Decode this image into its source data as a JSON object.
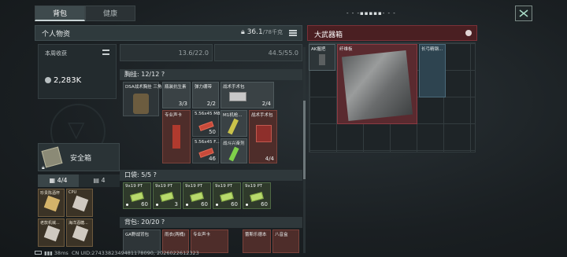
{
  "tabs": [
    {
      "label": "背包",
      "active": true
    },
    {
      "label": "健康",
      "active": false
    }
  ],
  "top_signal": "- - -▪▪▪▪▪- - -",
  "personal": {
    "title": "个人物资",
    "weight_current": "36.1",
    "weight_max": "/78千克",
    "capacity_left": "13.6/22.0",
    "capacity_right": "44.5/55.0"
  },
  "income": {
    "label": "本周收获",
    "value": "2,283K"
  },
  "safebox": {
    "label": "安全箱"
  },
  "subtabs": [
    {
      "label": "4/4",
      "active": true
    },
    {
      "label": "4",
      "active": false
    }
  ],
  "pocket_items": [
    {
      "name": "珍贵陈酒杯"
    },
    {
      "name": "CPU"
    },
    {
      "name": "老款机械..."
    },
    {
      "name": "海洋酒糖..."
    }
  ],
  "chest": {
    "header": "胸挂: 12/12 ?",
    "items": [
      {
        "name": "DSA战术胸挂 三角",
        "qty": ""
      },
      {
        "name": "瓶装抗生素",
        "qty": "3/3"
      },
      {
        "name": "弹力绷带",
        "qty": "2/2"
      },
      {
        "name": "战术手术包",
        "qty": "2/4"
      },
      {
        "name": "专业声卡",
        "qty": ""
      },
      {
        "name": "5.56x45 M855A1",
        "qty": "50"
      },
      {
        "name": "M1机枪...",
        "qty": ""
      },
      {
        "name": "5.56x45 F...",
        "qty": "46"
      },
      {
        "name": "战斗兴奋剂",
        "qty": ""
      },
      {
        "name": "战术手术包",
        "qty": "4/4"
      }
    ]
  },
  "pockets": {
    "header": "口袋: 5/5 ?",
    "items": [
      {
        "name": "9x19 PT",
        "qty": "60"
      },
      {
        "name": "9x19 PT",
        "qty": "3"
      },
      {
        "name": "9x19 PT",
        "qty": "60"
      },
      {
        "name": "9x19 PT",
        "qty": "60"
      },
      {
        "name": "9x19 PT",
        "qty": "60"
      }
    ]
  },
  "backpack": {
    "header": "背包: 20/20 ?",
    "items": [
      {
        "name": "GA野战背包"
      },
      {
        "name": "雨衣(两桶)"
      },
      {
        "name": "专业声卡"
      },
      {
        "name": "蕾斯乐德本"
      },
      {
        "name": "八音盒"
      }
    ]
  },
  "armory": {
    "title": "大武器箱",
    "items": [
      {
        "name": "AK握把"
      },
      {
        "name": "纤维板"
      },
      {
        "name": "长弓精钢..."
      }
    ]
  },
  "status": {
    "ping": "38ms",
    "uid": "CN UID:2743382349481178090, 2026022612323"
  }
}
